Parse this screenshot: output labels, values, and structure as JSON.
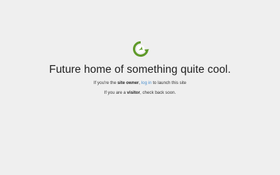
{
  "colors": {
    "background": "#efefef",
    "logo_green": "#5f9a2a",
    "link_blue": "#4b8fcf"
  },
  "logo": {
    "icon": "gator-clock-icon"
  },
  "headline": "Future home of something quite cool.",
  "owner_line": {
    "prefix": "If you're the ",
    "role": "site owner",
    "comma": ", ",
    "link": "log in",
    "suffix": " to launch this site"
  },
  "visitor_line": {
    "prefix": "If you are a ",
    "role": "visitor",
    "suffix": ", check back soon."
  }
}
